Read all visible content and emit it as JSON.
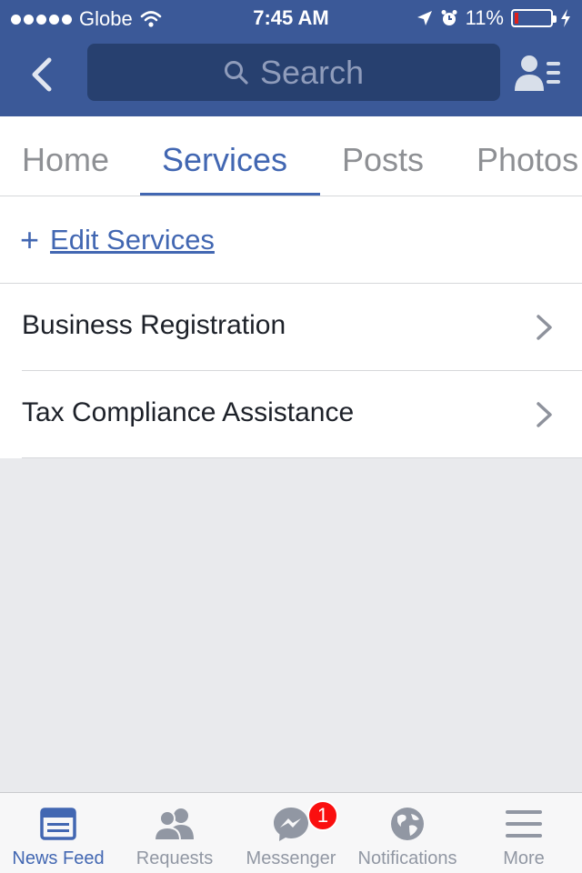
{
  "status_bar": {
    "carrier": "Globe",
    "time": "7:45 AM",
    "battery": "11%",
    "battery_level": 0.11
  },
  "navbar": {
    "search_placeholder": "Search"
  },
  "tabs": [
    {
      "label": "Home",
      "active": false
    },
    {
      "label": "Services",
      "active": true
    },
    {
      "label": "Posts",
      "active": false
    },
    {
      "label": "Photos",
      "active": false
    }
  ],
  "edit_services": {
    "plus": "+",
    "label": "Edit Services"
  },
  "services": [
    {
      "label": "Business Registration"
    },
    {
      "label": "Tax Compliance Assistance"
    }
  ],
  "tabbar": {
    "items": [
      {
        "label": "News Feed",
        "icon": "news-feed-icon",
        "active": true
      },
      {
        "label": "Requests",
        "icon": "requests-icon",
        "active": false
      },
      {
        "label": "Messenger",
        "icon": "messenger-icon",
        "active": false
      },
      {
        "label": "Notifications",
        "icon": "globe-icon",
        "active": false
      },
      {
        "label": "More",
        "icon": "menu-icon",
        "active": false
      }
    ],
    "messenger_badge": "1"
  },
  "colors": {
    "brand_blue": "#3b5998",
    "accent_blue": "#4267b2",
    "badge_red": "#fa0f0f",
    "battery_red": "#e0201a"
  }
}
